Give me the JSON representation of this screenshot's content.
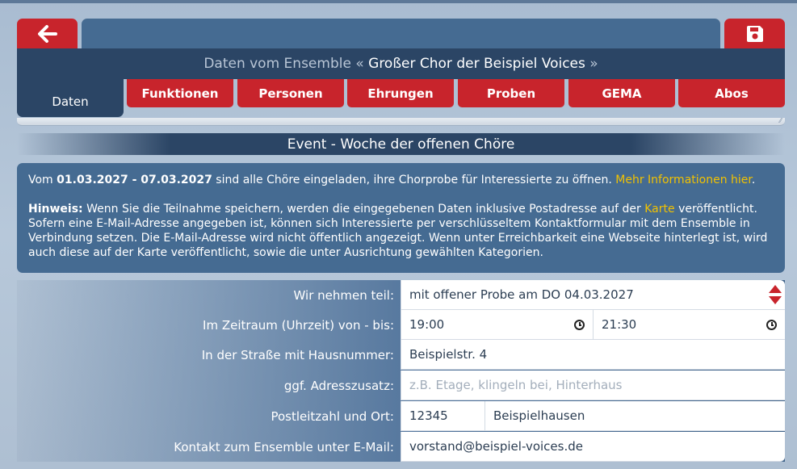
{
  "header": {
    "prefix": "Daten vom Ensemble",
    "quote_open": "«",
    "ensemble_name": "Großer Chor der Beispiel Voices",
    "quote_close": "»"
  },
  "tabs": [
    {
      "label": "Daten",
      "active": true
    },
    {
      "label": "Funktionen",
      "active": false
    },
    {
      "label": "Personen",
      "active": false
    },
    {
      "label": "Ehrungen",
      "active": false
    },
    {
      "label": "Proben",
      "active": false
    },
    {
      "label": "GEMA",
      "active": false
    },
    {
      "label": "Abos",
      "active": false
    }
  ],
  "event": {
    "title": "Event - Woche der offenen Chöre"
  },
  "info": {
    "line1_pre": "Vom ",
    "line1_dates": "01.03.2027 - 07.03.2027",
    "line1_mid": " sind alle Chöre eingeladen, ihre Chorprobe für Interessierte zu öffnen. ",
    "line1_link": "Mehr Informationen hier",
    "line1_end": ".",
    "hint_label": "Hinweis:",
    "hint_text1": " Wenn Sie die Teilnahme speichern, werden die eingegebenen Daten inklusive Postadresse auf der ",
    "hint_link": "Karte",
    "hint_text2": " veröffentlicht. Sofern eine E-Mail-Adresse angegeben ist, können sich Interessierte per verschlüsseltem Kontaktformular mit dem Ensemble in Verbindung setzen. Die E-Mail-Adresse wird nicht öffentlich angezeigt. Wenn unter Erreichbarkeit eine Webseite hinterlegt ist, wird auch diese auf der Karte veröffentlicht, sowie die unter Ausrichtung gewählten Kategorien."
  },
  "form": {
    "participation": {
      "label": "Wir nehmen teil:",
      "value": "mit offener Probe am DO 04.03.2027"
    },
    "time": {
      "label": "Im Zeitraum (Uhrzeit) von - bis:",
      "from": "19:00",
      "to": "21:30"
    },
    "street": {
      "label": "In der Straße mit Hausnummer:",
      "value": "Beispielstr. 4"
    },
    "address_extra": {
      "label": "ggf. Adresszusatz:",
      "value": "",
      "placeholder": "z.B. Etage, klingeln bei, Hinterhaus"
    },
    "city": {
      "label": "Postleitzahl und Ort:",
      "zip": "12345",
      "city": "Beispielhausen"
    },
    "email": {
      "label": "Kontakt zum Ensemble unter E-Mail:",
      "value": "vorstand@beispiel-voices.de"
    }
  },
  "colors": {
    "accent_red": "#c8242c",
    "panel_dark": "#2b4565",
    "panel_mid": "#456b92",
    "link_yellow": "#f2c200"
  }
}
